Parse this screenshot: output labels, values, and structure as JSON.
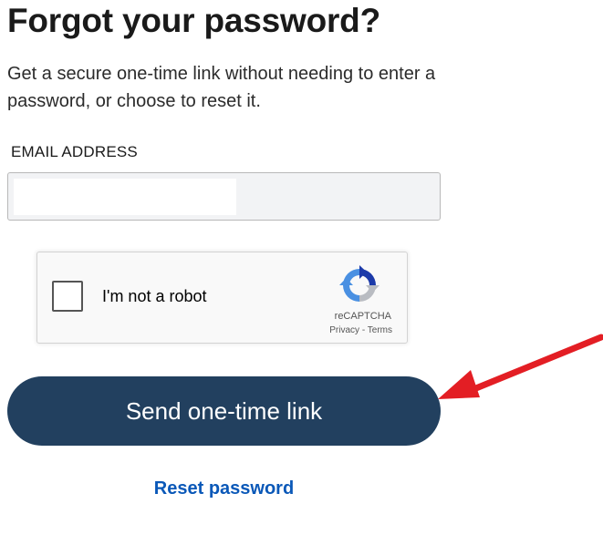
{
  "header": {
    "title": "Forgot your password?",
    "subtitle": "Get a secure one-time link without needing to enter a password, or choose to reset it."
  },
  "form": {
    "email_label": "EMAIL ADDRESS",
    "email_value": "",
    "email_placeholder": ""
  },
  "recaptcha": {
    "label": "I'm not a robot",
    "brand": "reCAPTCHA",
    "privacy_link": "Privacy",
    "separator": " - ",
    "terms_link": "Terms",
    "checked": false
  },
  "actions": {
    "send_link_label": "Send one-time link",
    "reset_password_label": "Reset password"
  },
  "colors": {
    "primary_button": "#22405f",
    "link": "#0a58b8",
    "annotation_arrow": "#e31e24"
  },
  "icons": {
    "recaptcha_logo": "recaptcha-logo-icon",
    "annotation": "red-arrow-annotation"
  }
}
